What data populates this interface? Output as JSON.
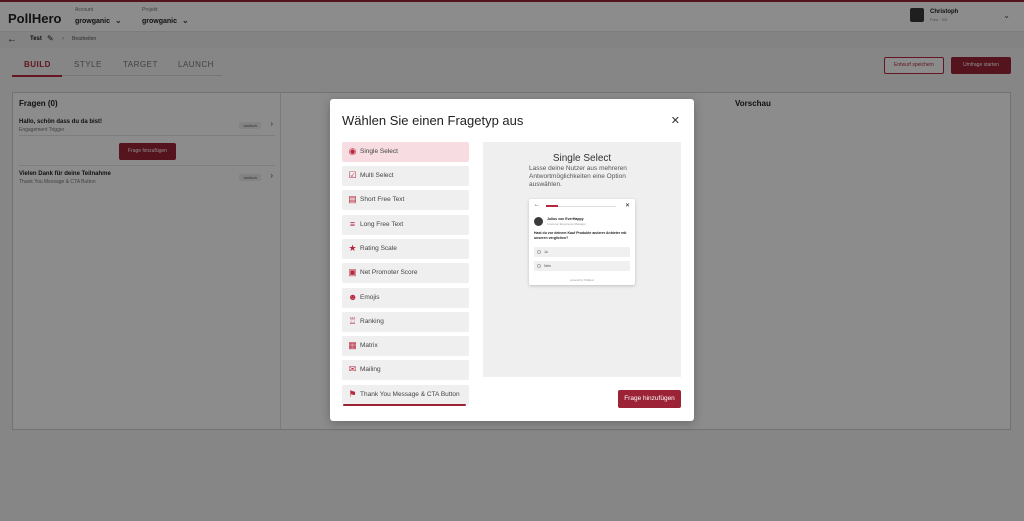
{
  "header": {
    "logo_text": "PollHero",
    "account": {
      "label": "Account",
      "value": "growganic"
    },
    "project": {
      "label": "Projekt",
      "value": "growganic"
    },
    "user": {
      "name": "Christoph",
      "sub": "Free · 0/0"
    }
  },
  "breadcrumb": {
    "title": "Test",
    "current": "Bearbeiten"
  },
  "tabs": [
    {
      "label": "BUILD",
      "active": true
    },
    {
      "label": "STYLE",
      "active": false
    },
    {
      "label": "TARGET",
      "active": false
    },
    {
      "label": "LAUNCH",
      "active": false
    }
  ],
  "actions": {
    "save_draft": "Entwurf speichern",
    "launch": "Umfrage starten"
  },
  "questions_panel": {
    "title": "Fragen (0)",
    "items": [
      {
        "title": "Hallo, schön dass du da bist!",
        "subtitle": "Engagement Trigger",
        "badge": "statisch"
      },
      {
        "title": "Vielen Dank für deine Teilnahme",
        "subtitle": "Thank You Message & CTA Button",
        "badge": "statisch"
      }
    ],
    "add_button": "Frage hinzufügen"
  },
  "preview_panel": {
    "title": "Vorschau"
  },
  "modal": {
    "title": "Wählen Sie einen Fragetyp aus",
    "types": [
      {
        "label": "Single Select",
        "icon": "radio-icon",
        "active": true
      },
      {
        "label": "Multi Select",
        "icon": "checkbox-icon",
        "active": false
      },
      {
        "label": "Short Free Text",
        "icon": "short-text-icon",
        "active": false
      },
      {
        "label": "Long Free Text",
        "icon": "long-text-icon",
        "active": false
      },
      {
        "label": "Rating Scale",
        "icon": "star-icon",
        "active": false
      },
      {
        "label": "Net Promoter Score",
        "icon": "nps-icon",
        "active": false
      },
      {
        "label": "Emojis",
        "icon": "emoji-icon",
        "active": false
      },
      {
        "label": "Ranking",
        "icon": "ranking-icon",
        "active": false
      },
      {
        "label": "Matrix",
        "icon": "matrix-icon",
        "active": false
      },
      {
        "label": "Mailing",
        "icon": "mail-icon",
        "active": false
      },
      {
        "label": "Thank You Message & CTA Button",
        "icon": "flag-icon",
        "active": false
      }
    ],
    "preview": {
      "title": "Single Select",
      "description": "Lasse deine Nutzer aus mehreren Antwortmöglichkeiten eine Option auswählen.",
      "card": {
        "name": "Julius von EverHappy",
        "sub": "Customer Experience Manager",
        "question": "Hast du vor deinem Kauf Produkte anderer Anbieter mit unseren verglichen?",
        "options": [
          "Ja",
          "Nein"
        ],
        "powered": "powered by PollHero"
      }
    },
    "add_button": "Frage hinzufügen"
  },
  "colors": {
    "accent": "#9b2335",
    "accent_light": "#f7dde1"
  }
}
